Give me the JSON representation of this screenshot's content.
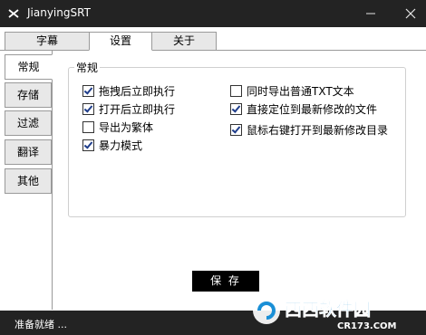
{
  "window": {
    "title": "JianyingSRT",
    "minimize_glyph": "—",
    "close_glyph": "✕"
  },
  "top_tabs": [
    {
      "label": "字幕",
      "active": false
    },
    {
      "label": "设置",
      "active": true
    },
    {
      "label": "关于",
      "active": false
    }
  ],
  "side_tabs": [
    {
      "label": "常规",
      "active": true
    },
    {
      "label": "存储",
      "active": false
    },
    {
      "label": "过滤",
      "active": false
    },
    {
      "label": "翻译",
      "active": false
    },
    {
      "label": "其他",
      "active": false
    }
  ],
  "general": {
    "group_title": "常规",
    "options_left": [
      {
        "label": "拖拽后立即执行",
        "checked": true
      },
      {
        "label": "打开后立即执行",
        "checked": true
      },
      {
        "label": "导出为繁体",
        "checked": false
      },
      {
        "label": "暴力模式",
        "checked": true
      }
    ],
    "options_right": [
      {
        "label": "同时导出普通TXT文本",
        "checked": false
      },
      {
        "label": "直接定位到最新修改的文件",
        "checked": true
      },
      {
        "label": "鼠标右键打开到最新修改目录",
        "checked": true
      }
    ]
  },
  "save_button": "保 存",
  "status": "准备就绪 ...",
  "watermark": {
    "text_cn": "西西软件园",
    "text_en": "CR173.COM"
  },
  "colors": {
    "titlebar": "#232323",
    "tab_inactive": "#e8e8e8",
    "border": "#9a9a9a",
    "button": "#000000"
  }
}
